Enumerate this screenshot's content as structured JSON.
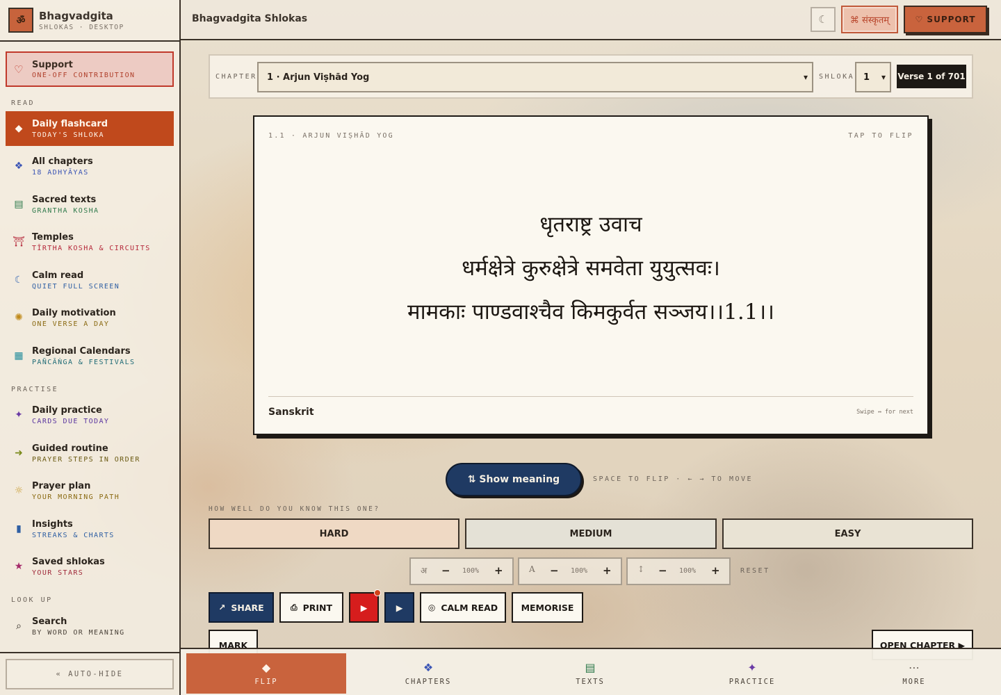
{
  "brand": {
    "logo": "ॐ",
    "title": "Bhagvadgita",
    "subtitle": "SHLOKAS · DESKTOP"
  },
  "support_card": {
    "icon": "♡",
    "title": "Support",
    "subtitle": "ONE-OFF CONTRIBUTION"
  },
  "sections": {
    "read": "READ",
    "practise": "PRACTISE",
    "look_up": "LOOK UP"
  },
  "nav": [
    {
      "icon": "◆",
      "icon_color": "#fff6ec",
      "title": "Daily flashcard",
      "subtitle": "TODAY'S SHLOKA",
      "sub_color": "#fff6ec",
      "active": true
    },
    {
      "icon": "❖",
      "icon_color": "#3a54b5",
      "title": "All chapters",
      "subtitle": "18 ADHYĀYAS",
      "sub_color": "#3a54b5"
    },
    {
      "icon": "▤",
      "icon_color": "#2f7a4c",
      "title": "Sacred texts",
      "subtitle": "GRANTHA KOSHA",
      "sub_color": "#2f7a4c"
    },
    {
      "icon": "⛩",
      "icon_color": "#b5283a",
      "title": "Temples",
      "subtitle": "TĪRTHA KOSHA & CIRCUITS",
      "sub_color": "#b5283a"
    },
    {
      "icon": "☾",
      "icon_color": "#3a6ab5",
      "title": "Calm read",
      "subtitle": "QUIET FULL SCREEN",
      "sub_color": "#2f5fa3"
    },
    {
      "icon": "✺",
      "icon_color": "#c08a1a",
      "title": "Daily motivation",
      "subtitle": "ONE VERSE A DAY",
      "sub_color": "#8a6a12"
    },
    {
      "icon": "▦",
      "icon_color": "#1f8a9a",
      "title": "Regional Calendars",
      "subtitle": "PAÑCĀṄGA & FESTIVALS",
      "sub_color": "#1f6b76"
    },
    {
      "icon": "✦",
      "icon_color": "#6a3aa5",
      "title": "Daily practice",
      "subtitle": "CARDS DUE TODAY",
      "sub_color": "#5a35a0"
    },
    {
      "icon": "➜",
      "icon_color": "#7a8a1a",
      "title": "Guided routine",
      "subtitle": "PRAYER STEPS IN ORDER",
      "sub_color": "#6a5a12"
    },
    {
      "icon": "☼",
      "icon_color": "#c89a2a",
      "title": "Prayer plan",
      "subtitle": "YOUR MORNING PATH",
      "sub_color": "#8a6a12"
    },
    {
      "icon": "▮",
      "icon_color": "#2f5fa3",
      "title": "Insights",
      "subtitle": "STREAKS & CHARTS",
      "sub_color": "#2f5fa3"
    },
    {
      "icon": "★",
      "icon_color": "#a52a6a",
      "title": "Saved shlokas",
      "subtitle": "YOUR STARS",
      "sub_color": "#a02a3a"
    },
    {
      "icon": "⌕",
      "icon_color": "#2b241d",
      "title": "Search",
      "subtitle": "BY WORD OR MEANING",
      "sub_color": "#4a4239"
    }
  ],
  "autohide": "« AUTO-HIDE",
  "header": {
    "title": "Bhagvadgita Shlokas",
    "moon_icon": "☾",
    "script_btn": "⌘ संस्कृतम्",
    "support_btn": "♡ SUPPORT"
  },
  "selector": {
    "chapter_label": "CHAPTER",
    "chapter_value": "1 · Arjun Viṣhād Yog",
    "shloka_label": "SHLOKA",
    "shloka_value": "1",
    "verse_badge": "Verse 1 of 701"
  },
  "card": {
    "ref": "1.1 · ARJUN VIṢHĀD YOG",
    "tap": "TAP TO FLIP",
    "lines": [
      "धृतराष्ट्र उवाच",
      "धर्मक्षेत्रे कुरुक्षेत्रे समवेता युयुत्सवः।",
      "मामकाः पाण्डवाश्चैव किमकुर्वत सञ्जय।।1.1।।"
    ],
    "language": "Sanskrit",
    "swipe": "Swipe ↔ for next"
  },
  "show_meaning": "⇅ Show meaning",
  "hint": "SPACE TO FLIP · ← → TO MOVE",
  "rating": {
    "question": "HOW WELL DO YOU KNOW THIS ONE?",
    "hard": "HARD",
    "medium": "MEDIUM",
    "easy": "EASY",
    "hard_bg": "#efd9c4",
    "medium_bg": "#e4e1d6",
    "easy_bg": "#e9e3d4"
  },
  "sizers": [
    {
      "glyph": "अ",
      "minus": "−",
      "value": "100%",
      "plus": "+"
    },
    {
      "glyph": "A",
      "minus": "−",
      "value": "100%",
      "plus": "+"
    },
    {
      "glyph": "↕",
      "minus": "−",
      "value": "100%",
      "plus": "+"
    }
  ],
  "reset": "RESET",
  "actions": {
    "share": "SHARE",
    "share_icon": "↗",
    "print": "PRINT",
    "print_icon": "⎙",
    "play_red": "▶",
    "play_navy": "▶",
    "calm": "CALM READ",
    "calm_icon": "◎",
    "memorise": "MEMORISE",
    "mark": "MARK",
    "open_chapter": "OPEN CHAPTER ▶"
  },
  "tabs": [
    {
      "icon": "◆",
      "icon_color": "#fdf3e9",
      "label": "FLIP",
      "active": true
    },
    {
      "icon": "❖",
      "icon_color": "#3a54b5",
      "label": "CHAPTERS"
    },
    {
      "icon": "▤",
      "icon_color": "#2f7a4c",
      "label": "TEXTS"
    },
    {
      "icon": "✦",
      "icon_color": "#6a3aa5",
      "label": "PRACTICE"
    },
    {
      "icon": "⋯",
      "icon_color": "#6b6259",
      "label": "MORE"
    }
  ],
  "colors": {
    "accent": "#c0491c",
    "navy": "#1f3a63",
    "ink": "#1d1915"
  }
}
